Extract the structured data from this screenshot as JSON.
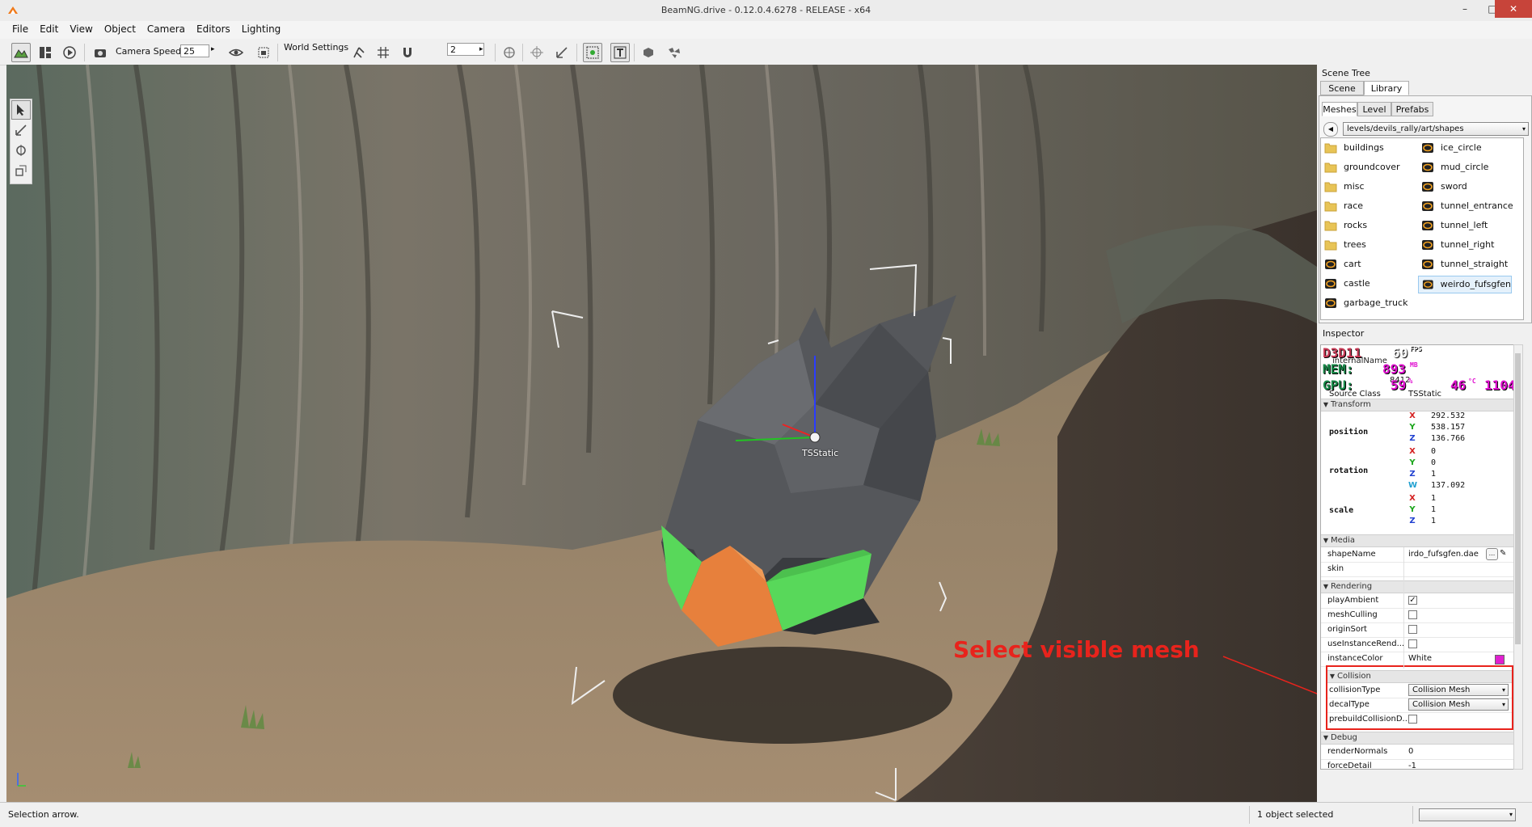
{
  "window": {
    "title": "BeamNG.drive - 0.12.0.4.6278 - RELEASE - x64",
    "minimize": "–",
    "maximize": "□",
    "close": "✕"
  },
  "menu": [
    "File",
    "Edit",
    "View",
    "Object",
    "Camera",
    "Editors",
    "Lighting"
  ],
  "toolbar": {
    "camera_speed_label": "Camera Speed",
    "camera_speed_value": "25",
    "world_settings_label": "World Settings",
    "grid_value": "2",
    "spin_up": "▸"
  },
  "viewport": {
    "object_label": "TSStatic",
    "annotation": "Select visible mesh",
    "colors": {
      "mesh_gray": "#55575b",
      "mesh_orange": "#e7803c",
      "mesh_green": "#58d85a",
      "annotation": "#e8231c"
    }
  },
  "scene_tree": {
    "title": "Scene Tree",
    "tabs": [
      "Scene",
      "Library"
    ],
    "active_tab": "Library",
    "subtabs": [
      "Meshes",
      "Level",
      "Prefabs"
    ],
    "active_subtab": "Meshes",
    "path": "levels/devils_rally/art/shapes",
    "back_icon": "◀",
    "dropdown_arrow": "▾",
    "items_left": [
      {
        "name": "buildings",
        "type": "folder"
      },
      {
        "name": "groundcover",
        "type": "folder"
      },
      {
        "name": "misc",
        "type": "folder"
      },
      {
        "name": "race",
        "type": "folder"
      },
      {
        "name": "rocks",
        "type": "folder"
      },
      {
        "name": "trees",
        "type": "folder"
      },
      {
        "name": "cart",
        "type": "mesh"
      },
      {
        "name": "castle",
        "type": "mesh"
      },
      {
        "name": "garbage_truck",
        "type": "mesh"
      }
    ],
    "items_right": [
      {
        "name": "ice_circle",
        "type": "mesh"
      },
      {
        "name": "mud_circle",
        "type": "mesh"
      },
      {
        "name": "sword",
        "type": "mesh"
      },
      {
        "name": "tunnel_entrance",
        "type": "mesh"
      },
      {
        "name": "tunnel_left",
        "type": "mesh"
      },
      {
        "name": "tunnel_right",
        "type": "mesh"
      },
      {
        "name": "tunnel_straight",
        "type": "mesh"
      },
      {
        "name": "weirdo_fufsgfen",
        "type": "mesh",
        "selected": true
      }
    ]
  },
  "hud": {
    "api": "D3D11",
    "fps": "60",
    "fps_unit": "FPS",
    "mem_label": "MEM:",
    "mem_value": "893",
    "mem_unit": "MB",
    "gpu_label": "GPU:",
    "gpu_value": "59",
    "gpu_unit": "%",
    "temp_value": "46",
    "temp_unit": "°C",
    "clock_value": "1104",
    "colors": {
      "d3d": "#c83a56",
      "mem": "#1a8a4a",
      "gpu_label": "#1a8a4a",
      "values": "#e010d0",
      "white": "#ffffff"
    }
  },
  "inspector": {
    "title": "Inspector",
    "partial_rows": [
      {
        "label": "internalName",
        "value": ""
      },
      {
        "label": "",
        "value": "8412"
      },
      {
        "label": "Source Class",
        "value": "TSStatic"
      }
    ],
    "transform": {
      "title": "Transform",
      "position_label": "position",
      "position": [
        {
          "axis": "X",
          "value": "292.532"
        },
        {
          "axis": "Y",
          "value": "538.157"
        },
        {
          "axis": "Z",
          "value": "136.766"
        }
      ],
      "rotation_label": "rotation",
      "rotation": [
        {
          "axis": "X",
          "value": "0"
        },
        {
          "axis": "Y",
          "value": "0"
        },
        {
          "axis": "Z",
          "value": "1"
        },
        {
          "axis": "W",
          "value": "137.092"
        }
      ],
      "scale_label": "scale",
      "scale": [
        {
          "axis": "X",
          "value": "1"
        },
        {
          "axis": "Y",
          "value": "1"
        },
        {
          "axis": "Z",
          "value": "1"
        }
      ],
      "axis_colors": {
        "X": "#d42020",
        "Y": "#1aa51a",
        "Z": "#2040d0",
        "W": "#20a0d0"
      }
    },
    "media": {
      "title": "Media",
      "shapeName_label": "shapeName",
      "shapeName_value": "irdo_fufsgfen.dae",
      "browse_label": "...",
      "skin_label": "skin"
    },
    "rendering": {
      "title": "Rendering",
      "rows": [
        {
          "label": "playAmbient",
          "checked": true
        },
        {
          "label": "meshCulling",
          "checked": false
        },
        {
          "label": "originSort",
          "checked": false
        },
        {
          "label": "useInstanceRend...",
          "checked": false
        }
      ],
      "instanceColor_label": "instanceColor",
      "instanceColor_value": "White",
      "instanceColor_swatch": "#e020d0",
      "check_mark": "✓"
    },
    "collision": {
      "title": "Collision",
      "collisionType_label": "collisionType",
      "collisionType_value": "Collision Mesh",
      "decalType_label": "decalType",
      "decalType_value": "Collision Mesh",
      "prebuild_label": "prebuildCollisionD..."
    },
    "debug": {
      "title": "Debug",
      "renderNormals_label": "renderNormals",
      "renderNormals_value": "0",
      "forceDetail_label": "forceDetail",
      "forceDetail_value": "-1"
    }
  },
  "status": {
    "left": "Selection arrow.",
    "middle": "1 object selected"
  }
}
